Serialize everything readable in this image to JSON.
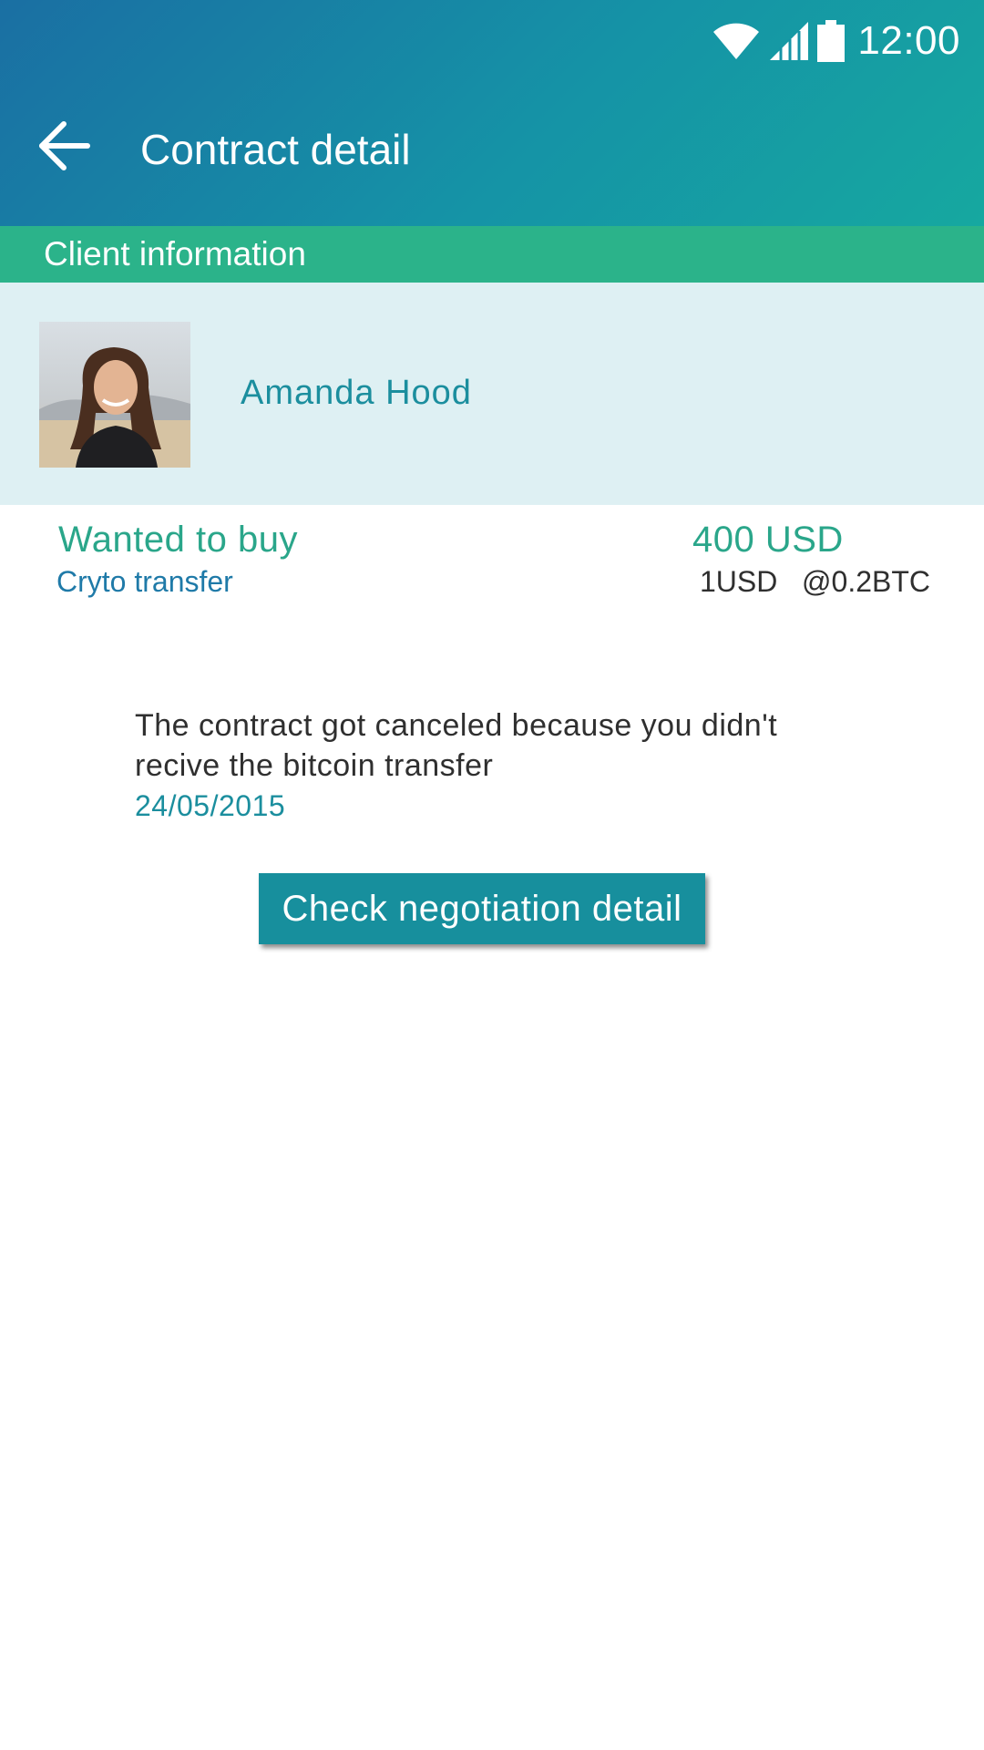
{
  "status_bar": {
    "time": "12:00",
    "icons": [
      "wifi-icon",
      "signal-icon",
      "battery-icon"
    ]
  },
  "appbar": {
    "back_icon": "arrow-left-icon",
    "title": "Contract detail"
  },
  "client_section": {
    "header": "Client information",
    "client_name": "Amanda Hood",
    "avatar": "profile-photo"
  },
  "offer": {
    "type": "Wanted to buy",
    "method": "Cryto transfer",
    "amount": "400 USD",
    "rate": "1USD   @0.2BTC"
  },
  "message": {
    "text": "The contract got canceled because you didn't recive the bitcoin transfer",
    "date": "24/05/2015"
  },
  "actions": {
    "check_negotiation_label": "Check negotiation detail"
  },
  "colors": {
    "appbar_start": "#1a6fa3",
    "appbar_end": "#16a8a0",
    "section_header": "#2bb38a",
    "client_card_bg": "#def0f3",
    "accent_teal": "#178f9d",
    "accent_green": "#2aa68a"
  }
}
